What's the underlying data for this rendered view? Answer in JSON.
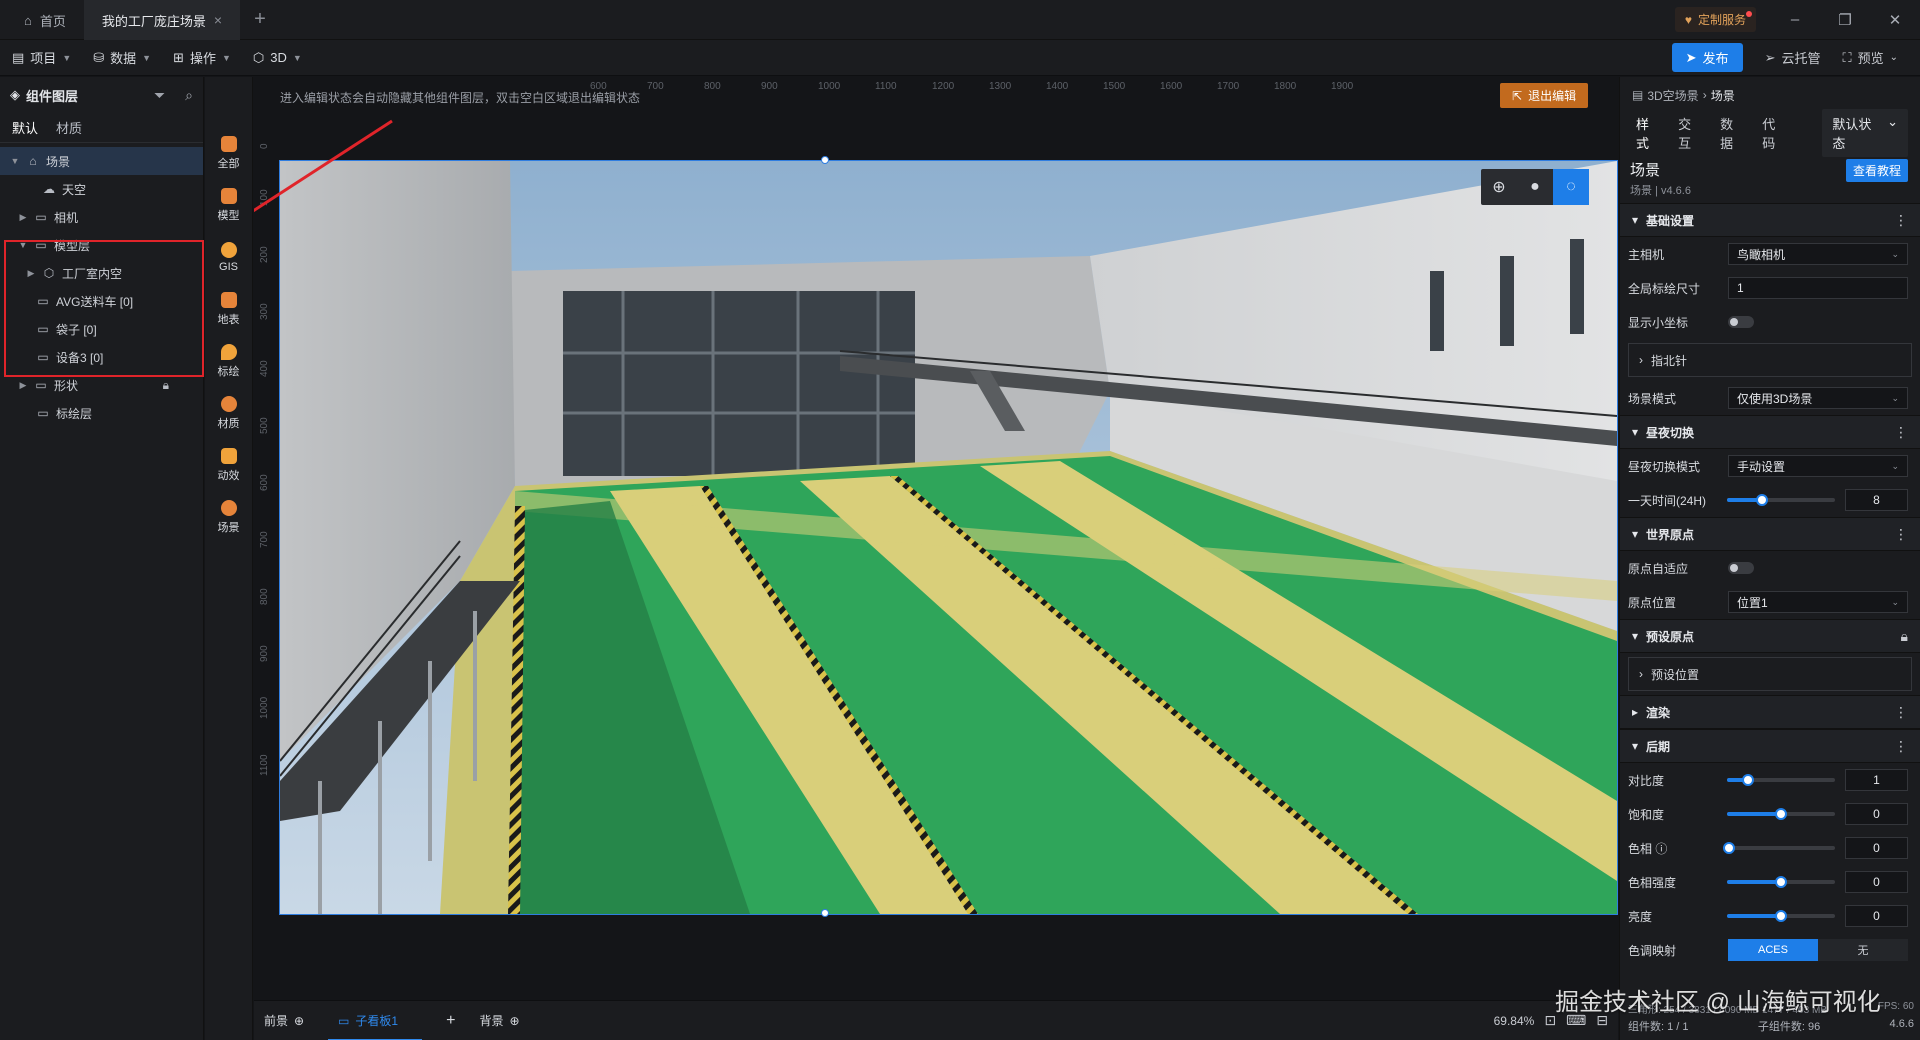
{
  "tabs": [
    {
      "label": "首页"
    },
    {
      "label": "我的工厂庞庄场景"
    }
  ],
  "custom_service": "定制服务",
  "menu": {
    "items": [
      {
        "label": "项目"
      },
      {
        "label": "数据"
      },
      {
        "label": "操作"
      },
      {
        "label": "3D"
      }
    ],
    "publish": "发布",
    "cloud": "云托管",
    "preview": "预览"
  },
  "left_panel": {
    "title": "组件图层",
    "tabs": [
      "默认",
      "材质"
    ],
    "tree": [
      {
        "label": "场景"
      },
      {
        "label": "天空"
      },
      {
        "label": "相机"
      },
      {
        "label": "模型层"
      },
      {
        "label": "工厂室内空"
      },
      {
        "label": "AVG送料车 [0]"
      },
      {
        "label": "袋子 [0]"
      },
      {
        "label": "设备3 [0]"
      },
      {
        "label": "形状"
      },
      {
        "label": "标绘层"
      }
    ]
  },
  "icon_strip": [
    {
      "label": "全部",
      "color": "#e6843a"
    },
    {
      "label": "模型",
      "color": "#e6843a"
    },
    {
      "label": "GIS",
      "color": "#f0a33b"
    },
    {
      "label": "地表",
      "color": "#e6843a"
    },
    {
      "label": "标绘",
      "color": "#f0a33b"
    },
    {
      "label": "材质",
      "color": "#e6843a"
    },
    {
      "label": "动效",
      "color": "#f0a33b"
    },
    {
      "label": "场景",
      "color": "#e6843a"
    }
  ],
  "canvas": {
    "hint": "进入编辑状态会自动隐藏其他组件图层，双击空白区域退出编辑状态",
    "exit_edit": "退出编辑",
    "ruler_top": [
      "600",
      "700",
      "800",
      "900",
      "1000",
      "1100",
      "1200",
      "1300",
      "1400",
      "1500",
      "1600",
      "1700",
      "1800",
      "1900"
    ],
    "ruler_left": [
      "0",
      "100",
      "200",
      "300",
      "400",
      "500",
      "600",
      "700",
      "800",
      "900",
      "1000",
      "1100"
    ]
  },
  "bottom": {
    "front": "前景",
    "board": "子看板1",
    "back": "背景",
    "zoom": "69.84%"
  },
  "right_panel": {
    "breadcrumb_parent": "3D空场景",
    "breadcrumb_current": "场景",
    "tabs": [
      "样式",
      "交互",
      "数据",
      "代码"
    ],
    "state": "默认状态",
    "title": "场景",
    "subtitle": "场景 | v4.6.6",
    "tutorial": "查看教程",
    "sections": {
      "basic": "基础设置",
      "daynight": "昼夜切换",
      "origin": "世界原点",
      "preset": "预设原点",
      "render": "渲染",
      "post": "后期"
    },
    "fields": {
      "main_camera_label": "主相机",
      "main_camera_value": "鸟瞰相机",
      "marker_size_label": "全局标绘尺寸",
      "marker_size_value": "1",
      "show_axis_label": "显示小坐标",
      "compass": "指北针",
      "scene_mode_label": "场景模式",
      "scene_mode_value": "仅使用3D场景",
      "daynight_mode_label": "昼夜切换模式",
      "daynight_mode_value": "手动设置",
      "daytime_label": "一天时间(24H)",
      "daytime_value": "8",
      "origin_adapt_label": "原点自适应",
      "origin_pos_label": "原点位置",
      "origin_pos_value": "位置1",
      "preset_pos": "预设位置",
      "contrast_label": "对比度",
      "contrast_value": "1",
      "saturation_label": "饱和度",
      "saturation_value": "0",
      "hue_label": "色相",
      "hue_value": "0",
      "hue_intensity_label": "色相强度",
      "hue_intensity_value": "0",
      "brightness_label": "亮度",
      "brightness_value": "0",
      "tonemap_label": "色调映射",
      "tonemap_on": "ACES",
      "tonemap_off": "无"
    },
    "sliders": {
      "daytime": 0.33,
      "contrast": 0.2,
      "saturation": 0.5,
      "hue": 0.02,
      "hue_intensity": 0.5,
      "brightness": 0.5
    },
    "stats": {
      "left": "三角形: 254 / 3831 / 4090 MB  1477 / 403 MB",
      "right": "FPS: 60"
    },
    "footer": {
      "components": "组件数: 1 / 1",
      "sub_components": "子组件数: 96",
      "version": "4.6.6"
    }
  },
  "watermark": "掘金技术社区 @ 山海鲸可视化",
  "colors": {
    "accent": "#1e7ee8",
    "highlight": "#e0242a",
    "floor_green": "#2fa55a",
    "floor_yellow": "#d9cf7a"
  }
}
